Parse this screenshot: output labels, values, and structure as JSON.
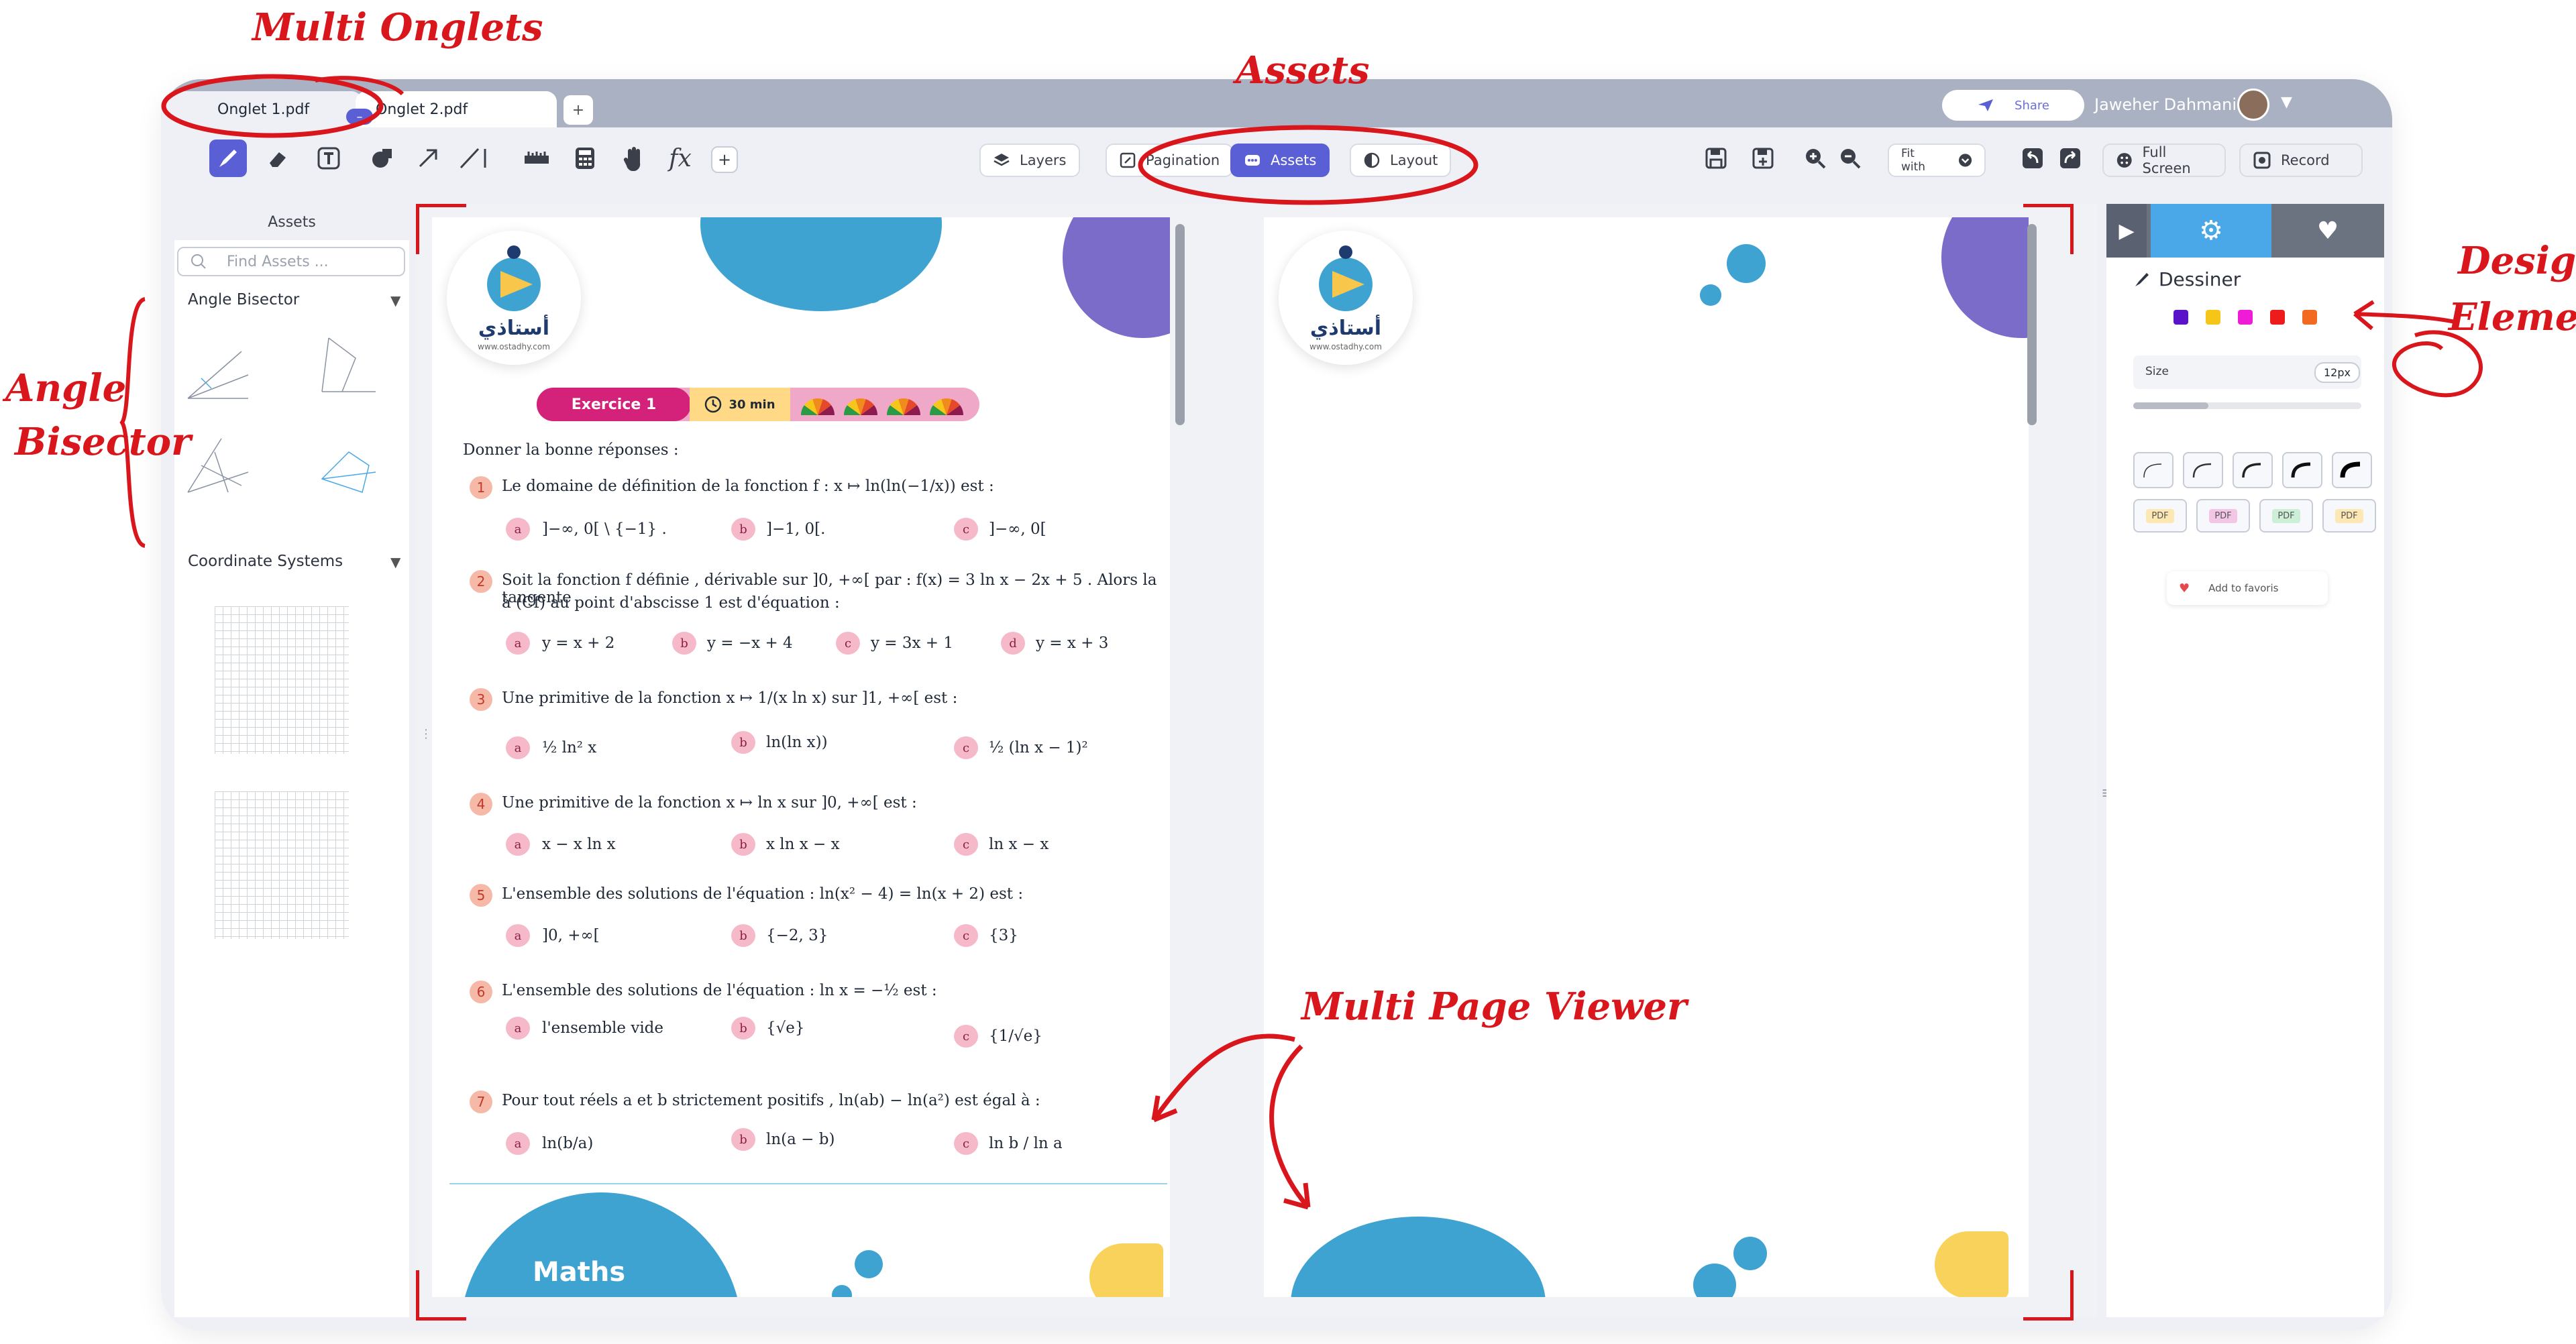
{
  "tabs": [
    {
      "label": "Onglet 1.pdf"
    },
    {
      "label": "Onglet 2.pdf"
    }
  ],
  "tab_add_label": "+",
  "share_label": "Share",
  "user": {
    "name": "Jaweher Dahmani"
  },
  "toolbar": {
    "add_label": "+",
    "layers_label": "Layers",
    "pagination_label": "Pagination",
    "assets_label": "Assets",
    "layout_label": "Layout",
    "zoom_label": "Fit with",
    "fullscreen_label": "Full Screen",
    "record_label": "Record"
  },
  "left_panel": {
    "tab_label": "Assets",
    "search_placeholder": "Find Assets ...",
    "sections": [
      {
        "title": "Angle Bisector"
      },
      {
        "title": "Coordinate Systems"
      }
    ]
  },
  "page1": {
    "logo_text": "أستاذي",
    "logo_sub": "www.ostadhy.com",
    "exercise_label": "Exercice 1",
    "time_label": "30 min",
    "intro": "Donner la bonne réponses :",
    "questions": [
      {
        "num": "1",
        "text": "Le domaine de définition de la fonction f : x ↦ ln(ln(−1/x)) est :",
        "options": [
          {
            "mark": "a",
            "text": "]−∞, 0[ \\ {−1} ."
          },
          {
            "mark": "b",
            "text": "]−1, 0[."
          },
          {
            "mark": "c",
            "text": "]−∞, 0["
          }
        ]
      },
      {
        "num": "2",
        "text": "Soit la fonction f définie , dérivable sur ]0, +∞[ par : f(x) = 3 ln x − 2x + 5 . Alors la tangente",
        "text2": "à (Cf) au point d'abscisse 1 est d'équation :",
        "options": [
          {
            "mark": "a",
            "text": "y = x + 2"
          },
          {
            "mark": "b",
            "text": "y = −x + 4"
          },
          {
            "mark": "c",
            "text": "y = 3x + 1"
          },
          {
            "mark": "d",
            "text": "y = x + 3"
          }
        ]
      },
      {
        "num": "3",
        "text": "Une primitive de la fonction x ↦ 1/(x ln x) sur ]1, +∞[ est :",
        "options": [
          {
            "mark": "a",
            "text": "½ ln² x"
          },
          {
            "mark": "b",
            "text": "ln(ln x))"
          },
          {
            "mark": "c",
            "text": "½ (ln x − 1)²"
          }
        ]
      },
      {
        "num": "4",
        "text": "Une primitive de la fonction x ↦ ln x sur ]0, +∞[ est :",
        "options": [
          {
            "mark": "a",
            "text": "x − x ln x"
          },
          {
            "mark": "b",
            "text": "x ln x − x"
          },
          {
            "mark": "c",
            "text": "ln x − x"
          }
        ]
      },
      {
        "num": "5",
        "text": "L'ensemble des solutions de l'équation : ln(x² − 4) = ln(x + 2) est :",
        "options": [
          {
            "mark": "a",
            "text": "]0, +∞["
          },
          {
            "mark": "b",
            "text": "{−2, 3}"
          },
          {
            "mark": "c",
            "text": "{3}"
          }
        ]
      },
      {
        "num": "6",
        "text": "L'ensemble des solutions de l'équation : ln x = −½ est :",
        "options": [
          {
            "mark": "a",
            "text": "l'ensemble vide"
          },
          {
            "mark": "b",
            "text": "{√e}"
          },
          {
            "mark": "c",
            "text": "{1/√e}"
          }
        ]
      },
      {
        "num": "7",
        "text": "Pour tout réels a et b strictement positifs , ln(ab) − ln(a²) est égal à :",
        "options": [
          {
            "mark": "a",
            "text": "ln(b/a)"
          },
          {
            "mark": "b",
            "text": "ln(a − b)"
          },
          {
            "mark": "c",
            "text": "ln b / ln a"
          }
        ]
      }
    ],
    "footer_label": "Maths"
  },
  "page2": {
    "logo_text": "أستاذي",
    "logo_sub": "www.ostadhy.com"
  },
  "right_panel": {
    "section_title": "Dessiner",
    "colors": [
      "#5b13c9",
      "#f5c518",
      "#f01bd7",
      "#ee1b1b",
      "#f26a21"
    ],
    "size_label": "Size",
    "size_value": "12px",
    "size_level": 0.33,
    "pdf_label": "PDF",
    "favorite_label": "Add to favoris"
  },
  "annotations": {
    "multi_onglets": "Multi Onglets",
    "assets": "Assets",
    "angle": "Angle",
    "bisector": "Bisector",
    "design": "Design",
    "elements": "Elements",
    "multi_page_viewer": "Multi Page Viewer"
  }
}
